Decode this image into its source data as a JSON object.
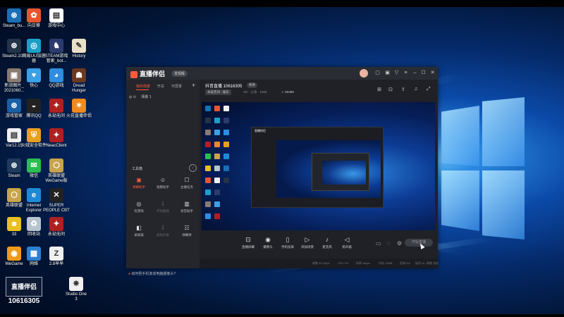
{
  "desktop": {
    "icons": [
      {
        "label": "Steam_bu...",
        "glyph": "⊛",
        "color": "#1b6fb5"
      },
      {
        "label": "向日葵",
        "glyph": "✿",
        "color": "#e8552e"
      },
      {
        "label": "游戏中心",
        "glyph": "▤",
        "color": "#ffffff"
      },
      {
        "label": "Steam2.10...",
        "glyph": "⊛",
        "color": "#243448"
      },
      {
        "label": "网易UU加速\n器",
        "glyph": "◎",
        "color": "#1aa0c8"
      },
      {
        "label": "STEAM游戏\n管家_bot...",
        "glyph": "♞",
        "color": "#2b3b6e"
      },
      {
        "label": "History",
        "glyph": "✎",
        "color": "#e8e0c8"
      },
      {
        "label": "新浪图片_\n2021060...",
        "glyph": "▣",
        "color": "#8a7a70"
      },
      {
        "label": "快心",
        "glyph": "♥",
        "color": "#3aa0e8"
      },
      {
        "label": "QQ游戏",
        "glyph": "◕",
        "color": "#2e8de0"
      },
      {
        "label": "Dread\nHunger",
        "glyph": "☗",
        "color": "#6b3a22"
      },
      {
        "label": "游戏管家",
        "glyph": "⊛",
        "color": "#1b5fa5"
      },
      {
        "label": "腾讯QQ",
        "glyph": "◒",
        "color": "#222222"
      },
      {
        "label": "永劫无间",
        "glyph": "✦",
        "color": "#b02020"
      },
      {
        "label": "火花直播伴侣",
        "glyph": "✶",
        "color": "#f08a1e"
      },
      {
        "label": "Var12.15",
        "glyph": "▤",
        "color": "#f0f0f0"
      },
      {
        "label": "火绒安全软件",
        "glyph": "⛨",
        "color": "#e8a020"
      },
      {
        "label": "NeacClient",
        "glyph": "✦",
        "color": "#b02020"
      },
      {
        "label": "Steam",
        "glyph": "⊛",
        "color": "#1f3a5c"
      },
      {
        "label": "微信",
        "glyph": "✉",
        "color": "#2bbd4e"
      },
      {
        "label": "英雄联盟\nWeGame版",
        "glyph": "⬡",
        "color": "#c8a44a"
      },
      {
        "label": "英雄联盟",
        "glyph": "⬡",
        "color": "#c8a44a"
      },
      {
        "label": "Internet\nExplorer",
        "glyph": "e",
        "color": "#1e8ad6"
      },
      {
        "label": "SUPER\nPEOPLE CBT",
        "glyph": "✕",
        "color": "#222222"
      },
      {
        "label": "33",
        "glyph": "☻",
        "color": "#e8c020"
      },
      {
        "label": "回收站",
        "glyph": "♻",
        "color": "#b8c4d0"
      },
      {
        "label": "永劫无间",
        "glyph": "✦",
        "color": "#b02020"
      },
      {
        "label": "WeGame",
        "glyph": "◉",
        "color": "#ef9a1a"
      },
      {
        "label": "网络",
        "glyph": "▦",
        "color": "#2e7fd0"
      },
      {
        "label": "2.8早早",
        "glyph": "Z",
        "color": "#f0f0f0"
      },
      {
        "label": "Studio One\n3",
        "glyph": "✵",
        "color": "#f0f0f0"
      }
    ],
    "badge": {
      "text": "10616305",
      "logo_text": "直播伴侣"
    }
  },
  "app": {
    "name": "直播伴侣",
    "version": "发现版",
    "left_tabs": [
      "我的场景",
      "开关",
      "可屏景"
    ],
    "scene_name": "场景 1",
    "tools_title": "工具箱",
    "tools": [
      {
        "label": "弹幕助手",
        "glyph": "▣",
        "style": "red"
      },
      {
        "label": "观看助手",
        "glyph": "☺",
        "style": ""
      },
      {
        "label": "主播任务",
        "glyph": "☐",
        "style": ""
      },
      {
        "label": "玩游戏",
        "glyph": "◎",
        "style": ""
      },
      {
        "label": "开场截图",
        "glyph": "⇩",
        "style": "dim"
      },
      {
        "label": "语音助手",
        "glyph": "▥",
        "style": ""
      },
      {
        "label": "录屏器",
        "glyph": "◧",
        "style": ""
      },
      {
        "label": "虚拟形象",
        "glyph": "⇩",
        "style": "dim"
      },
      {
        "label": "弹幕秀",
        "glyph": "☷",
        "style": ""
      }
    ],
    "hint": "如何把手机变成电脑摄像头?",
    "room": {
      "title": "抖音直播 10616305",
      "edit": "修改",
      "category": "永劫无间 - 娱乐",
      "meta": "1hr · 公会 · 1966",
      "views": "50489"
    },
    "preview": {
      "nested_title": "直播伴侣"
    },
    "controls": [
      {
        "label": "直播屏幕",
        "glyph": "⊡"
      },
      {
        "label": "摄像头",
        "glyph": "◉"
      },
      {
        "label": "手机投屏",
        "glyph": "▯"
      },
      {
        "label": "添加场景",
        "glyph": "▷"
      },
      {
        "label": "麦克风",
        "glyph": "♪"
      },
      {
        "label": "扬声器",
        "glyph": "◁"
      }
    ],
    "start_label": "开始直播",
    "status": [
      "帧数 30.00fps",
      "CPU 2%",
      "码率 0kbps",
      "内存 20MB",
      "丢帧 0%",
      "延时 2s",
      "网络 良好"
    ]
  }
}
